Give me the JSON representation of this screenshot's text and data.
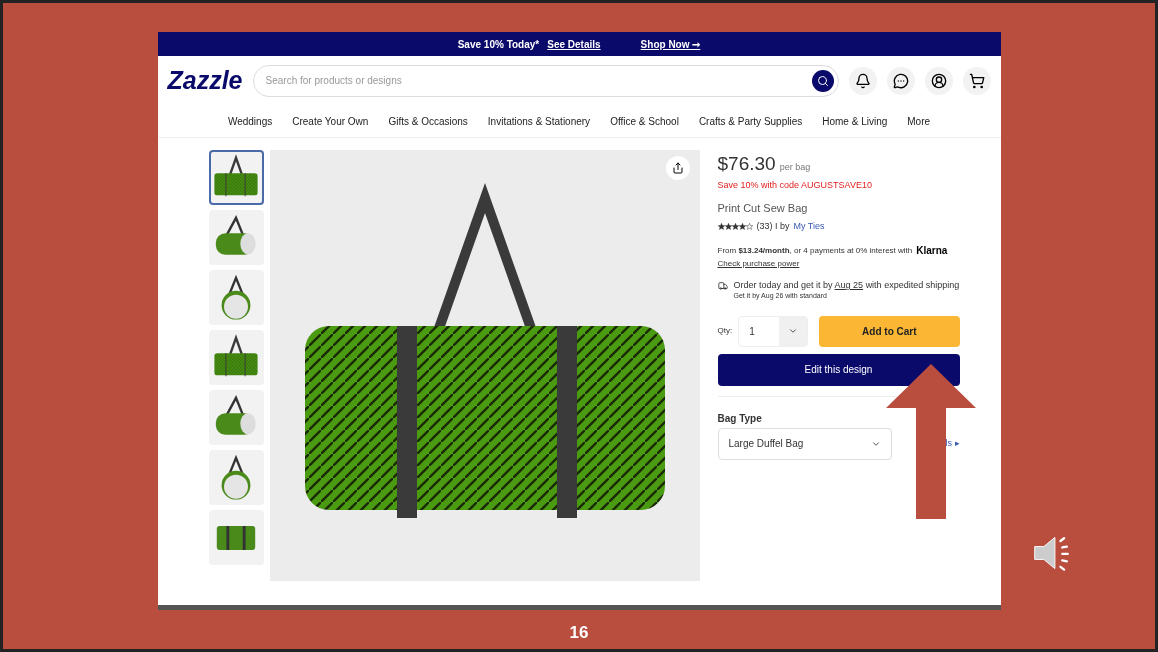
{
  "promo_bar": {
    "text": "Save 10% Today*",
    "details_link": "See Details",
    "shop_link": "Shop Now ➞"
  },
  "header": {
    "logo": "Zazzle",
    "search": {
      "placeholder": "Search for products or designs"
    }
  },
  "nav": [
    "Weddings",
    "Create Your Own",
    "Gifts & Occasions",
    "Invitations & Stationery",
    "Office & School",
    "Crafts & Party Supplies",
    "Home & Living",
    "More"
  ],
  "thumbnails": [
    {
      "kind": "front",
      "selected": true
    },
    {
      "kind": "angle",
      "selected": false
    },
    {
      "kind": "end",
      "selected": false
    },
    {
      "kind": "front",
      "selected": false
    },
    {
      "kind": "angle",
      "selected": false
    },
    {
      "kind": "end",
      "selected": false
    },
    {
      "kind": "top",
      "selected": false
    }
  ],
  "product": {
    "price": "$76.30",
    "price_unit": "per bag",
    "promo": "Save 10% with code AUGUSTSAVE10",
    "title": "Print Cut Sew Bag",
    "rating": {
      "stars": 4,
      "count": "(33) I by",
      "seller": "My Ties"
    },
    "financing": {
      "text": "From **$13.24/month**, or 4 payments at 0% interest with",
      "brand": "Klarna",
      "link": "Check purchase power"
    },
    "shipping": {
      "before": "Order today and get it by",
      "date": "Aug 25",
      "after": "with expedited shipping",
      "standard": "Get it by Aug 26 with standard"
    },
    "qty_label": "Qty:",
    "qty_value": "1",
    "add_to_cart": "Add to Cart",
    "edit_design": "Edit this design",
    "bag_type": {
      "label": "Bag Type",
      "value": "Large Duffel Bag",
      "details_link": "ls ▸"
    }
  },
  "slide": {
    "number": "16"
  }
}
